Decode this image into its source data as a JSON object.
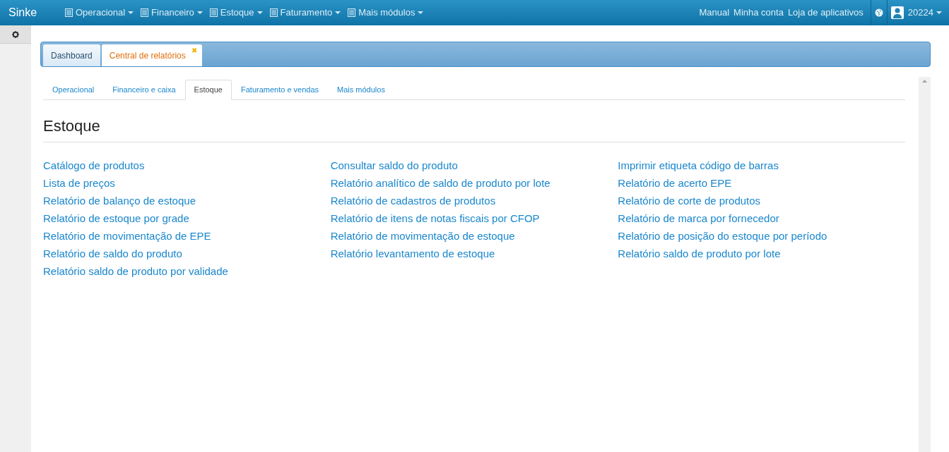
{
  "navbar": {
    "brand": "Sinke",
    "menus": [
      {
        "label": "Operacional"
      },
      {
        "label": "Financeiro"
      },
      {
        "label": "Estoque"
      },
      {
        "label": "Faturamento"
      },
      {
        "label": "Mais módulos"
      }
    ],
    "links": [
      "Manual",
      "Minha conta",
      "Loja de aplicativos"
    ],
    "user": "20224"
  },
  "page_tabs": [
    {
      "label": "Dashboard",
      "selected": false,
      "closable": false
    },
    {
      "label": "Central de relatórios",
      "selected": true,
      "closable": true
    }
  ],
  "close_mark": "✖",
  "section_tabs": [
    {
      "label": "Operacional",
      "selected": false
    },
    {
      "label": "Financeiro e caixa",
      "selected": false
    },
    {
      "label": "Estoque",
      "selected": true
    },
    {
      "label": "Faturamento e vendas",
      "selected": false
    },
    {
      "label": "Mais módulos",
      "selected": false
    }
  ],
  "heading": "Estoque",
  "columns": [
    [
      "Catálogo de produtos",
      "Lista de preços",
      "Relatório de balanço de estoque",
      "Relatório de estoque por grade",
      "Relatório de movimentação de EPE",
      "Relatório de saldo do produto",
      "Relatório saldo de produto por validade"
    ],
    [
      "Consultar saldo do produto",
      "Relatório analítico de saldo de produto por lote",
      "Relatório de cadastros de produtos",
      "Relatório de itens de notas fiscais por CFOP",
      "Relatório de movimentação de estoque",
      "Relatório levantamento de estoque"
    ],
    [
      "Imprimir etiqueta código de barras",
      "Relatório de acerto EPE",
      "Relatório de corte de produtos",
      "Relatório de marca por fornecedor",
      "Relatório de posição do estoque por período",
      "Relatório saldo de produto por lote"
    ]
  ]
}
